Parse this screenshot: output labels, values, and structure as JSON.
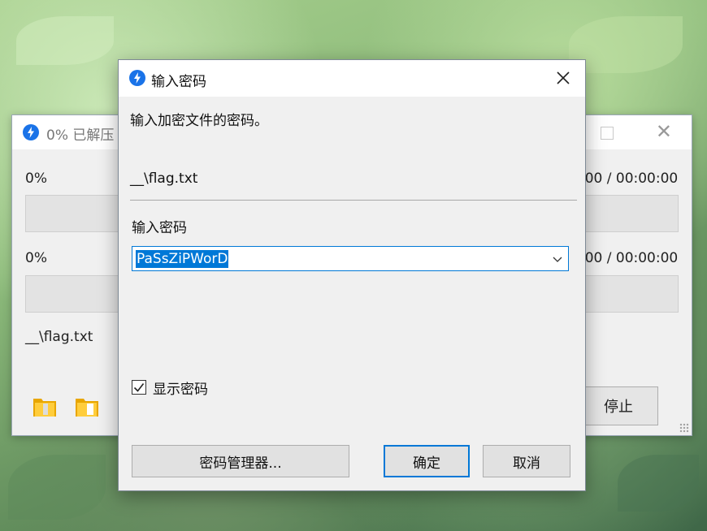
{
  "back_window": {
    "title": "0% 已解压",
    "progress1": "0%",
    "time1": "00:00:00 / 00:00:00",
    "progress2": "0%",
    "time2": "00:00:00 / 00:00:00",
    "file": "__\\flag.txt",
    "stop_label": "停止"
  },
  "dialog": {
    "title": "输入密码",
    "prompt": "输入加密文件的密码。",
    "file_name": "__\\flag.txt",
    "field_label": "输入密码",
    "password_value": "PaSsZiPWorD",
    "show_password_label": "显示密码",
    "show_password_checked": true,
    "password_manager_label": "密码管理器...",
    "ok_label": "确定",
    "cancel_label": "取消"
  },
  "colors": {
    "accent": "#0078d7",
    "app_icon": "#1a73e8"
  },
  "icons": [
    "app-icon",
    "close-icon",
    "chevron-down-icon",
    "folder-icon",
    "checkmark-icon"
  ]
}
